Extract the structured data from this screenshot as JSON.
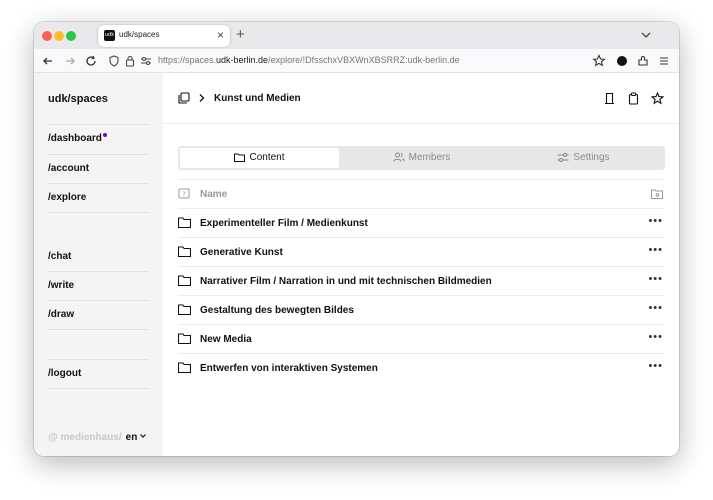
{
  "browser": {
    "tab_title": "udk/spaces",
    "tab_favicon_text": "udk",
    "url_prefix": "https://spaces.",
    "url_domain": "udk-berlin.de",
    "url_path": "/explore/!DfsschxVBXWnXBSRRZ:udk-berlin.de"
  },
  "sidebar": {
    "brand": "udk/spaces",
    "items": [
      {
        "label": "/dashboard",
        "notification": true
      },
      {
        "label": "/account"
      },
      {
        "label": "/explore"
      },
      {
        "label": "/chat"
      },
      {
        "label": "/write"
      },
      {
        "label": "/draw"
      },
      {
        "label": "/logout"
      }
    ],
    "footer_brand": "@ medienhaus/",
    "language": "en"
  },
  "main": {
    "title": "Kunst und Medien",
    "tabs": [
      {
        "label": "Content",
        "active": true
      },
      {
        "label": "Members"
      },
      {
        "label": "Settings"
      }
    ],
    "column_header": "Name",
    "rows": [
      "Experimenteller Film / Medienkunst",
      "Generative Kunst",
      "Narrativer Film / Narration in und mit technischen Bildmedien",
      "Gestaltung des bewegten Bildes",
      "New Media",
      "Entwerfen von interaktiven Systemen"
    ]
  },
  "colors": {
    "accent_dot": "#7a00e6",
    "sidebar_bg": "#f4f4f5",
    "segmented_bg": "#e7e7e8"
  }
}
